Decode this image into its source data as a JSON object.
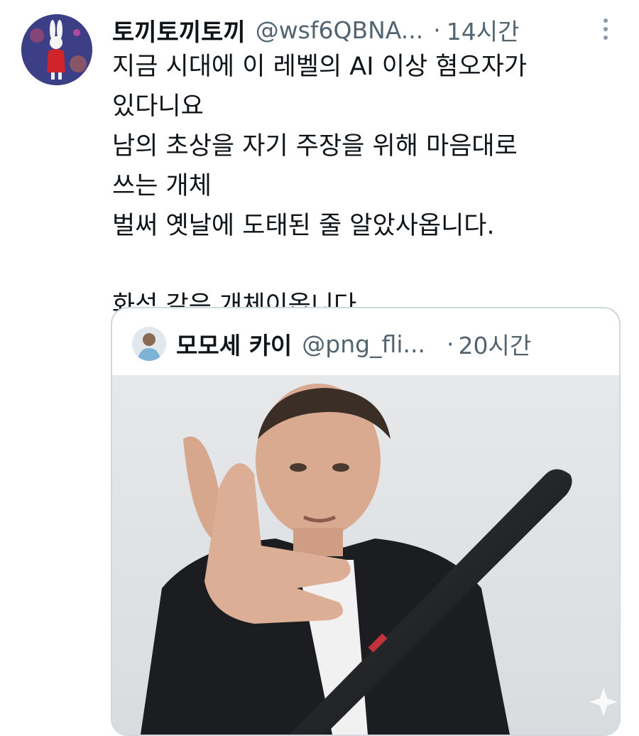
{
  "tweet": {
    "avatar_icon": "rabbit-avatar-icon",
    "display_name": "토끼토끼토끼",
    "handle": "@wsf6QBNA...",
    "separator": "·",
    "time": "14시간",
    "more_icon": "more-dots-icon",
    "text": "지금 시대에 이 레벨의 AI 이상 혐오자가\n있다니요\n남의 초상을 자기 주장을 위해 마음대로\n쓰는 개체\n벌써 옛날에 도태된 줄 알았사옵니다.\n\n화석 같은 개체이옵니다."
  },
  "quoted": {
    "avatar_icon": "user-avatar-icon",
    "display_name": "모모세 카이",
    "handle": "@png_fli...",
    "separator": "·",
    "time": "20시간",
    "media_icon": "photo-man-pointing-with-pen"
  },
  "colors": {
    "text_primary": "#0f1419",
    "text_secondary": "#536471",
    "border": "#cfd9de"
  }
}
